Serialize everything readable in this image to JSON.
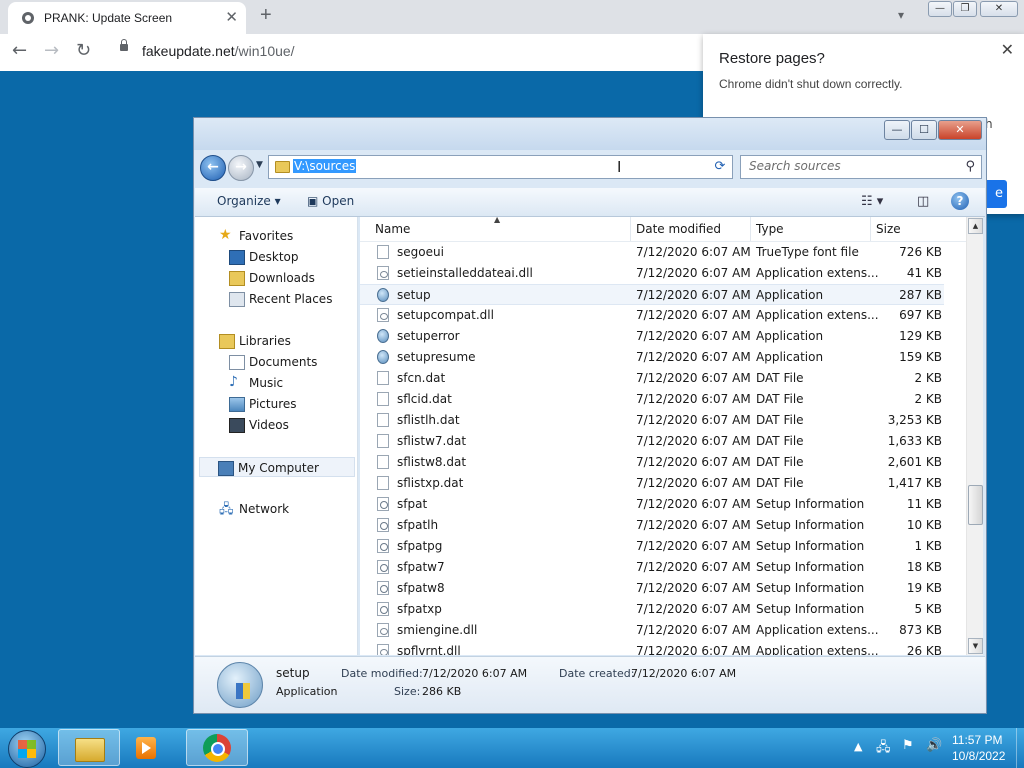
{
  "browser": {
    "tab_title": "PRANK: Update Screen",
    "tab_close": "✕",
    "new_tab": "+",
    "url_host": "fakeupdate.net",
    "url_path": "/win10ue/",
    "restore_title": "Restore pages?",
    "restore_msg": "Chrome didn't shut down correctly.",
    "restore_btn": "e",
    "restore_partial": "h"
  },
  "explorer": {
    "address": "V:\\sources",
    "search_placeholder": "Search sources",
    "organize": "Organize",
    "open": "Open",
    "nav": {
      "favorites": "Favorites",
      "desktop": "Desktop",
      "downloads": "Downloads",
      "recent": "Recent Places",
      "libraries": "Libraries",
      "documents": "Documents",
      "music": "Music",
      "pictures": "Pictures",
      "videos": "Videos",
      "computer": "My Computer",
      "network": "Network"
    },
    "columns": [
      "Name",
      "Date modified",
      "Type",
      "Size"
    ],
    "files": [
      {
        "name": "segoeui",
        "date": "7/12/2020 6:07 AM",
        "type": "TrueType font file",
        "size": "726 KB",
        "icon": "font-file-icon"
      },
      {
        "name": "setieinstalleddateai.dll",
        "date": "7/12/2020 6:07 AM",
        "type": "Application extens...",
        "size": "41 KB",
        "icon": "dll-file-icon"
      },
      {
        "name": "setup",
        "date": "7/12/2020 6:07 AM",
        "type": "Application",
        "size": "287 KB",
        "icon": "application-icon"
      },
      {
        "name": "setupcompat.dll",
        "date": "7/12/2020 6:07 AM",
        "type": "Application extens...",
        "size": "697 KB",
        "icon": "dll-file-icon"
      },
      {
        "name": "setuperror",
        "date": "7/12/2020 6:07 AM",
        "type": "Application",
        "size": "129 KB",
        "icon": "application-icon"
      },
      {
        "name": "setupresume",
        "date": "7/12/2020 6:07 AM",
        "type": "Application",
        "size": "159 KB",
        "icon": "application-icon"
      },
      {
        "name": "sfcn.dat",
        "date": "7/12/2020 6:07 AM",
        "type": "DAT File",
        "size": "2 KB",
        "icon": "file-icon"
      },
      {
        "name": "sflcid.dat",
        "date": "7/12/2020 6:07 AM",
        "type": "DAT File",
        "size": "2 KB",
        "icon": "file-icon"
      },
      {
        "name": "sflistlh.dat",
        "date": "7/12/2020 6:07 AM",
        "type": "DAT File",
        "size": "3,253 KB",
        "icon": "file-icon"
      },
      {
        "name": "sflistw7.dat",
        "date": "7/12/2020 6:07 AM",
        "type": "DAT File",
        "size": "1,633 KB",
        "icon": "file-icon"
      },
      {
        "name": "sflistw8.dat",
        "date": "7/12/2020 6:07 AM",
        "type": "DAT File",
        "size": "2,601 KB",
        "icon": "file-icon"
      },
      {
        "name": "sflistxp.dat",
        "date": "7/12/2020 6:07 AM",
        "type": "DAT File",
        "size": "1,417 KB",
        "icon": "file-icon"
      },
      {
        "name": "sfpat",
        "date": "7/12/2020 6:07 AM",
        "type": "Setup Information",
        "size": "11 KB",
        "icon": "setup-info-icon"
      },
      {
        "name": "sfpatlh",
        "date": "7/12/2020 6:07 AM",
        "type": "Setup Information",
        "size": "10 KB",
        "icon": "setup-info-icon"
      },
      {
        "name": "sfpatpg",
        "date": "7/12/2020 6:07 AM",
        "type": "Setup Information",
        "size": "1 KB",
        "icon": "setup-info-icon"
      },
      {
        "name": "sfpatw7",
        "date": "7/12/2020 6:07 AM",
        "type": "Setup Information",
        "size": "18 KB",
        "icon": "setup-info-icon"
      },
      {
        "name": "sfpatw8",
        "date": "7/12/2020 6:07 AM",
        "type": "Setup Information",
        "size": "19 KB",
        "icon": "setup-info-icon"
      },
      {
        "name": "sfpatxp",
        "date": "7/12/2020 6:07 AM",
        "type": "Setup Information",
        "size": "5 KB",
        "icon": "setup-info-icon"
      },
      {
        "name": "smiengine.dll",
        "date": "7/12/2020 6:07 AM",
        "type": "Application extens...",
        "size": "873 KB",
        "icon": "dll-file-icon"
      },
      {
        "name": "spflvrnt.dll",
        "date": "7/12/2020 6:07 AM",
        "type": "Application extens...",
        "size": "26 KB",
        "icon": "dll-file-icon"
      }
    ],
    "selected_file": "setup",
    "details": {
      "name": "setup",
      "type": "Application",
      "modified_label": "Date modified:",
      "modified_value": "7/12/2020 6:07 AM",
      "created_label": "Date created:",
      "created_value": "7/12/2020 6:07 AM",
      "size_label": "Size:",
      "size_value": "286 KB"
    }
  },
  "taskbar": {
    "time": "11:57 PM",
    "date": "10/8/2022"
  },
  "colors": {
    "desktop_bg": "#0a69a8",
    "selection": "#3399ff",
    "taskbar": "#1879be"
  }
}
